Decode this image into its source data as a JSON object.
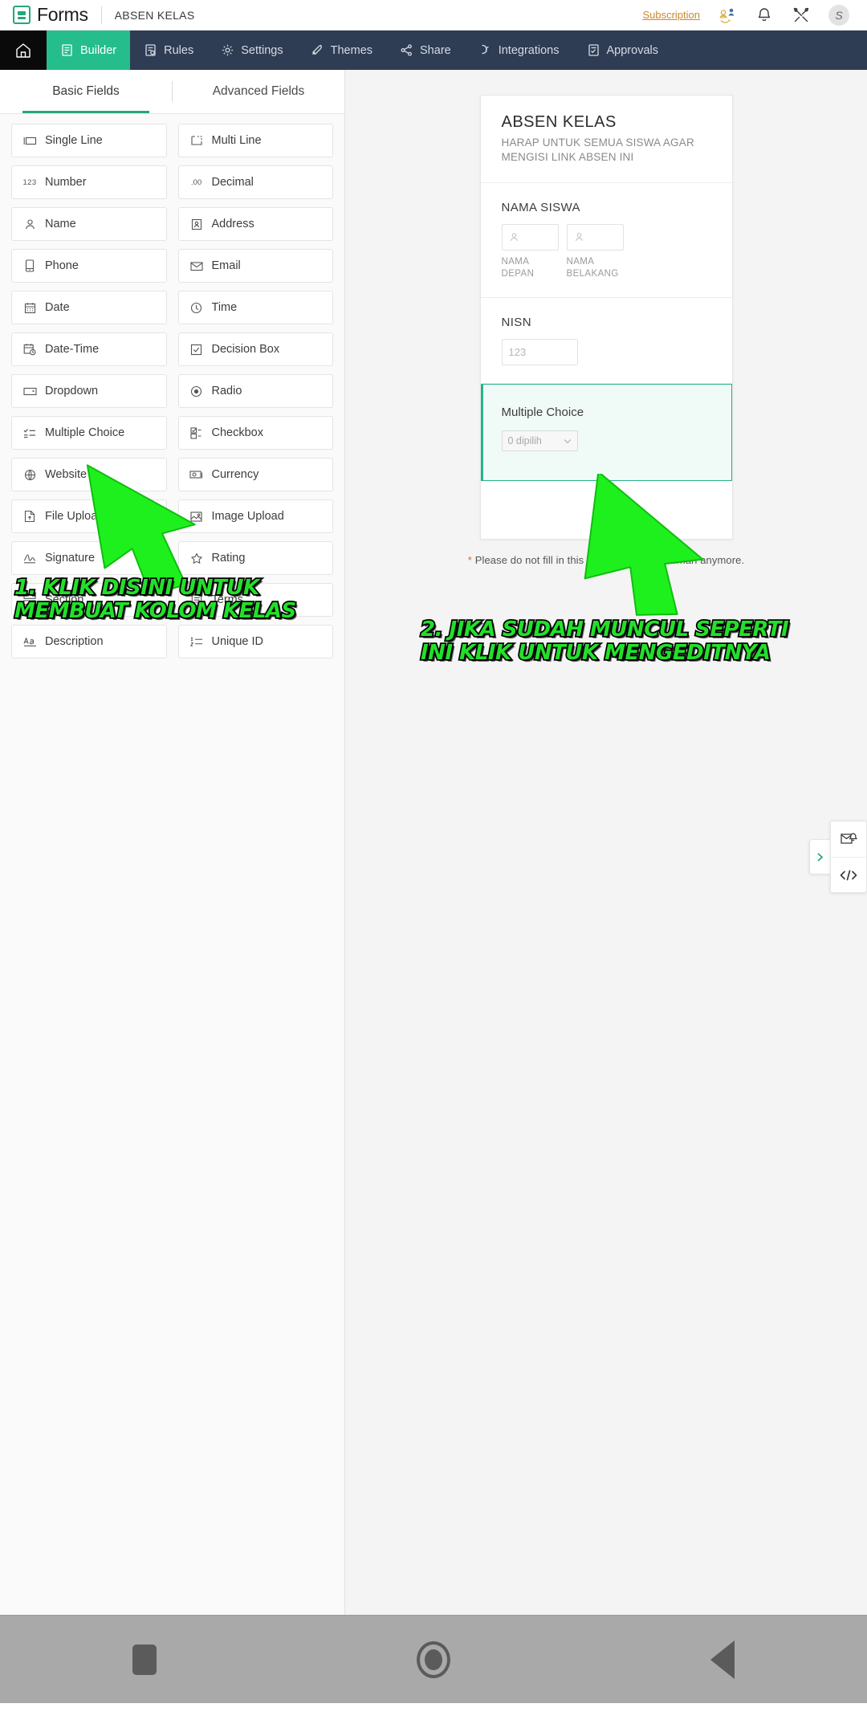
{
  "header": {
    "product_name": "Forms",
    "form_name": "ABSEN KELAS",
    "subscription_label": "Subscription",
    "avatar_initial": "S",
    "icons": [
      "share-users-icon",
      "bell-icon",
      "tools-icon"
    ]
  },
  "nav": {
    "home_icon": "home-icon",
    "items": [
      {
        "label": "Builder",
        "icon": "builder-icon",
        "active": true
      },
      {
        "label": "Rules",
        "icon": "rules-icon",
        "active": false
      },
      {
        "label": "Settings",
        "icon": "gear-icon",
        "active": false
      },
      {
        "label": "Themes",
        "icon": "themes-brush-icon",
        "active": false
      },
      {
        "label": "Share",
        "icon": "share-icon",
        "active": false
      },
      {
        "label": "Integrations",
        "icon": "integrations-icon",
        "active": false
      },
      {
        "label": "Approvals",
        "icon": "approvals-icon",
        "active": false
      }
    ]
  },
  "left_panel": {
    "tabs": [
      {
        "label": "Basic Fields",
        "active": true
      },
      {
        "label": "Advanced Fields",
        "active": false
      }
    ],
    "fields": [
      {
        "label": "Single Line",
        "icon": "single-line-icon"
      },
      {
        "label": "Multi Line",
        "icon": "multi-line-icon"
      },
      {
        "label": "Number",
        "icon": "number-123-icon"
      },
      {
        "label": "Decimal",
        "icon": "decimal-icon"
      },
      {
        "label": "Name",
        "icon": "person-icon"
      },
      {
        "label": "Address",
        "icon": "address-card-icon"
      },
      {
        "label": "Phone",
        "icon": "phone-icon"
      },
      {
        "label": "Email",
        "icon": "envelope-icon"
      },
      {
        "label": "Date",
        "icon": "calendar-icon"
      },
      {
        "label": "Time",
        "icon": "clock-icon"
      },
      {
        "label": "Date-Time",
        "icon": "calendar-clock-icon"
      },
      {
        "label": "Decision Box",
        "icon": "checkbox-square-icon"
      },
      {
        "label": "Dropdown",
        "icon": "dropdown-icon"
      },
      {
        "label": "Radio",
        "icon": "radio-icon"
      },
      {
        "label": "Multiple Choice",
        "icon": "multiple-choice-icon"
      },
      {
        "label": "Checkbox",
        "icon": "checkbox-list-icon"
      },
      {
        "label": "Website",
        "icon": "globe-icon"
      },
      {
        "label": "Currency",
        "icon": "currency-icon"
      },
      {
        "label": "File Upload",
        "icon": "file-upload-icon"
      },
      {
        "label": "Image Upload",
        "icon": "image-upload-icon"
      },
      {
        "label": "Signature",
        "icon": "signature-icon"
      },
      {
        "label": "Rating",
        "icon": "rating-icon"
      },
      {
        "label": "Section",
        "icon": "section-icon"
      },
      {
        "label": "Terms",
        "icon": "terms-icon"
      },
      {
        "label": "Description",
        "icon": "description-aa-icon"
      },
      {
        "label": "Unique ID",
        "icon": "unique-id-icon"
      }
    ]
  },
  "form_preview": {
    "title": "ABSEN KELAS",
    "description": "HARAP UNTUK SEMUA SISWA AGAR MENGISI LINK ABSEN INI",
    "name_field": {
      "label": "NAMA SISWA",
      "first_sublabel": "NAMA DEPAN",
      "last_sublabel": "NAMA BELAKANG",
      "input_icon": "person-icon"
    },
    "nisn_field": {
      "label": "NISN",
      "placeholder": "123"
    },
    "multiple_choice_field": {
      "label": "Multiple Choice",
      "select_value": "0 dipilih",
      "chevron_icon": "chevron-down-icon",
      "selected": true
    },
    "footnote_asterisk": "*",
    "footnote": "Please do not fill in this field if you are a human anymore."
  },
  "float_tools": {
    "expand_icon": "chevron-right-icon",
    "buttons": [
      {
        "icon": "envelope-bell-icon"
      },
      {
        "icon": "code-icon",
        "label": "</>"
      }
    ]
  },
  "annotations": [
    {
      "id": "anno1",
      "line1": "1. KLIK DISINI UNTUK",
      "line2": "MEMBUAT KOLOM KELAS"
    },
    {
      "id": "anno2",
      "line1": "2. JIKA SUDAH MUNCUL SEPERTI",
      "line2": "INI KLIK UNTUK MENGEDITNYA"
    }
  ],
  "android_nav": {
    "buttons": [
      {
        "icon": "recents-square-icon"
      },
      {
        "icon": "home-circle-icon"
      },
      {
        "icon": "back-triangle-icon"
      }
    ]
  },
  "colors": {
    "accent_teal": "#26a67a",
    "active_tab_green": "#25bd8b",
    "nav_blue": "#2e3c54",
    "subscription_gold": "#c8892e",
    "annotation_green": "#22e02a"
  }
}
